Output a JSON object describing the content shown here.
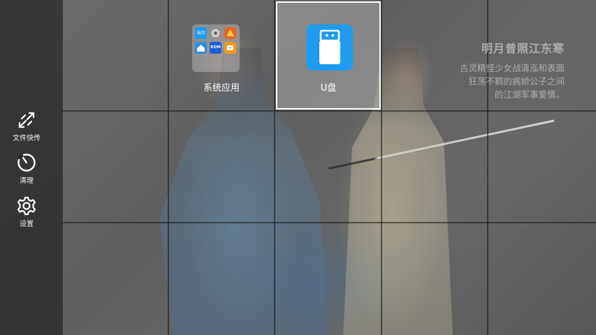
{
  "sidebar": {
    "items": [
      {
        "label": "文件快传",
        "icon": "share-arrows-icon"
      },
      {
        "label": "清理",
        "icon": "clean-dial-icon"
      },
      {
        "label": "设置",
        "icon": "gear-icon"
      }
    ]
  },
  "apps": [
    {
      "label": "系统应用",
      "icon": "app-folder-icon",
      "focused": false
    },
    {
      "label": "U盘",
      "icon": "usb-drive-icon",
      "focused": true
    }
  ],
  "folder_badges": {
    "app1": "当贝",
    "app5": "ROM"
  },
  "wallpaper": {
    "title": "明月曾照江东寒",
    "lines": [
      "古灵精怪少女战清泓和表面",
      "狂荡不羁的病娇公子之间",
      "的江湖军事爱情。"
    ]
  },
  "colors": {
    "accent": "#1e9bf0",
    "sidebar_bg": "#232323",
    "focus_border": "#ffffff"
  }
}
